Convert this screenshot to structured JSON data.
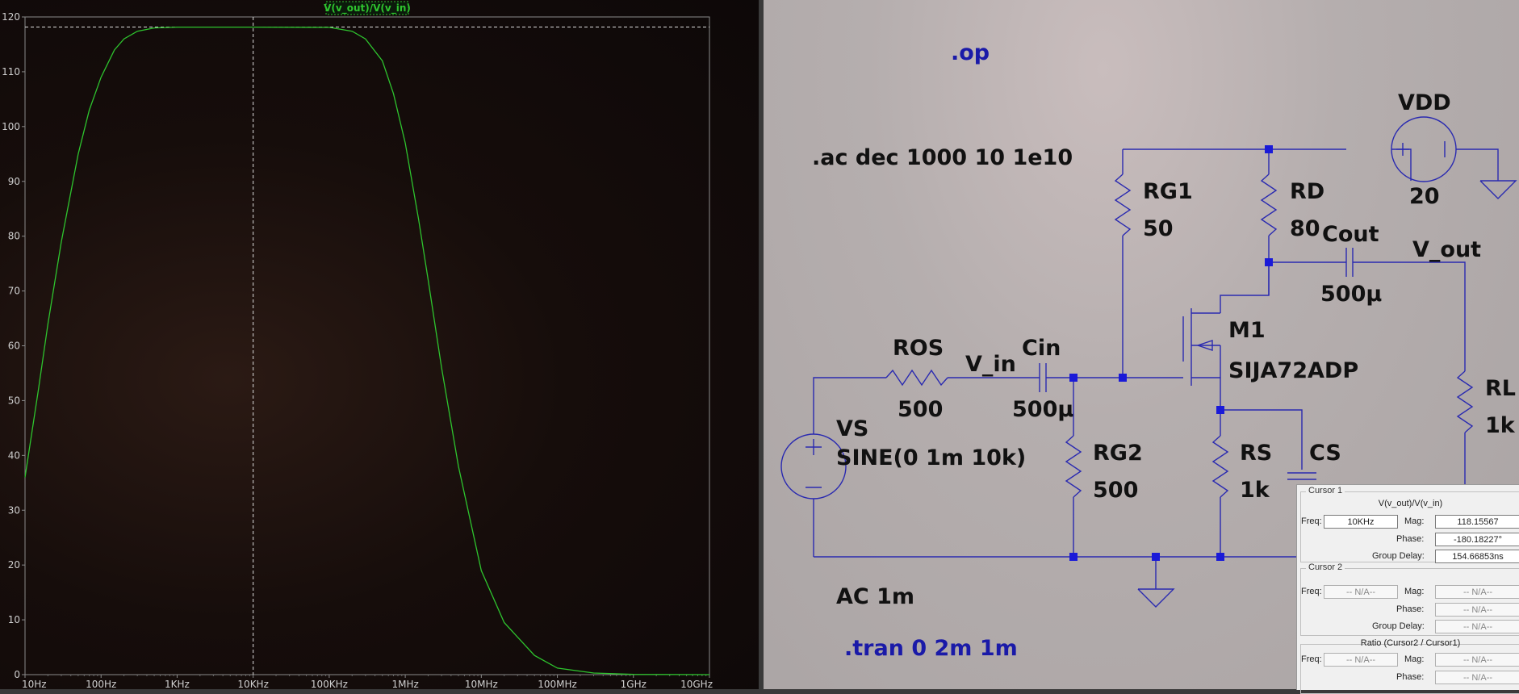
{
  "plot": {
    "trace_label": "V(v_out)/V(v_in)",
    "trace_color": "#2ec42e",
    "background": "#120b09",
    "y_ticks": [
      "0",
      "10",
      "20",
      "30",
      "40",
      "50",
      "60",
      "70",
      "80",
      "90",
      "100",
      "110",
      "120"
    ],
    "x_ticks": [
      "10Hz",
      "100Hz",
      "1KHz",
      "10KHz",
      "100KHz",
      "1MHz",
      "10MHz",
      "100MHz",
      "1GHz",
      "10GHz"
    ]
  },
  "chart_data": {
    "type": "line",
    "title": "V(v_out)/V(v_in)",
    "xscale": "log",
    "xlim": [
      10,
      10000000000
    ],
    "ylim": [
      0,
      120
    ],
    "series": [
      {
        "name": "V(v_out)/V(v_in)",
        "x": [
          10,
          15,
          20,
          30,
          50,
          70,
          100,
          150,
          200,
          300,
          500,
          1000,
          10000,
          100000,
          200000,
          300000,
          500000,
          700000,
          1000000,
          1500000,
          2000000,
          3000000,
          5000000,
          10000000,
          20000000,
          50000000,
          100000000,
          300000000,
          1000000000,
          10000000000
        ],
        "y": [
          36,
          52,
          64,
          79,
          95,
          103,
          109,
          114,
          116,
          117.4,
          118,
          118.15,
          118.15,
          118.1,
          117.4,
          116,
          112,
          106,
          97,
          83,
          72,
          56,
          38,
          19,
          9.5,
          3.5,
          1.2,
          0.3,
          0.05,
          0
        ]
      }
    ],
    "cursor_x": 10000,
    "cursor_y": 118.15567
  },
  "schematic": {
    "directives": [
      ".op",
      ".ac dec 1000 10 1e10",
      ".tran 0 2m 1m"
    ],
    "components": {
      "vdd_name": "VDD",
      "vdd_value": "20",
      "rg1_name": "RG1",
      "rg1_value": "50",
      "rd_name": "RD",
      "rd_value": "80",
      "cout_name": "Cout",
      "cout_value": "500µ",
      "m1_name": "M1",
      "m1_model": "SIJA72ADP",
      "ros_name": "ROS",
      "ros_value": "500",
      "cin_name": "Cin",
      "cin_value": "500µ",
      "vs_name": "VS",
      "vs_value": "SINE(0 1m 10k)",
      "vs_ac": "AC 1m",
      "rg2_name": "RG2",
      "rg2_value": "500",
      "rs_name": "RS",
      "rs_value": "1k",
      "cs_name": "CS",
      "rl_name": "RL",
      "rl_value": "1k"
    },
    "nets": {
      "vin": "V_in",
      "vout": "V_out"
    },
    "wire_color": "#2a2ab0",
    "text_color": "#111111",
    "directive_color": "#1a1aa8"
  },
  "cursor_panel": {
    "cursor1": {
      "title": "Cursor 1",
      "trace": "V(v_out)/V(v_in)",
      "freq_label": "Freq:",
      "freq": "10KHz",
      "mag_label": "Mag:",
      "mag": "118.15567",
      "phase_label": "Phase:",
      "phase": "-180.18227°",
      "gd_label": "Group Delay:",
      "gd": "154.66853ns"
    },
    "cursor2": {
      "title": "Cursor 2",
      "freq_label": "Freq:",
      "freq": "-- N/A--",
      "mag_label": "Mag:",
      "mag": "-- N/A--",
      "phase_label": "Phase:",
      "phase": "-- N/A--",
      "gd_label": "Group Delay:",
      "gd": "-- N/A--"
    },
    "ratio": {
      "title": "Ratio (Cursor2 / Cursor1)",
      "freq_label": "Freq:",
      "freq": "-- N/A--",
      "mag_label": "Mag:",
      "mag": "-- N/A--",
      "phase_label": "Phase:",
      "phase": "-- N/A--"
    }
  }
}
